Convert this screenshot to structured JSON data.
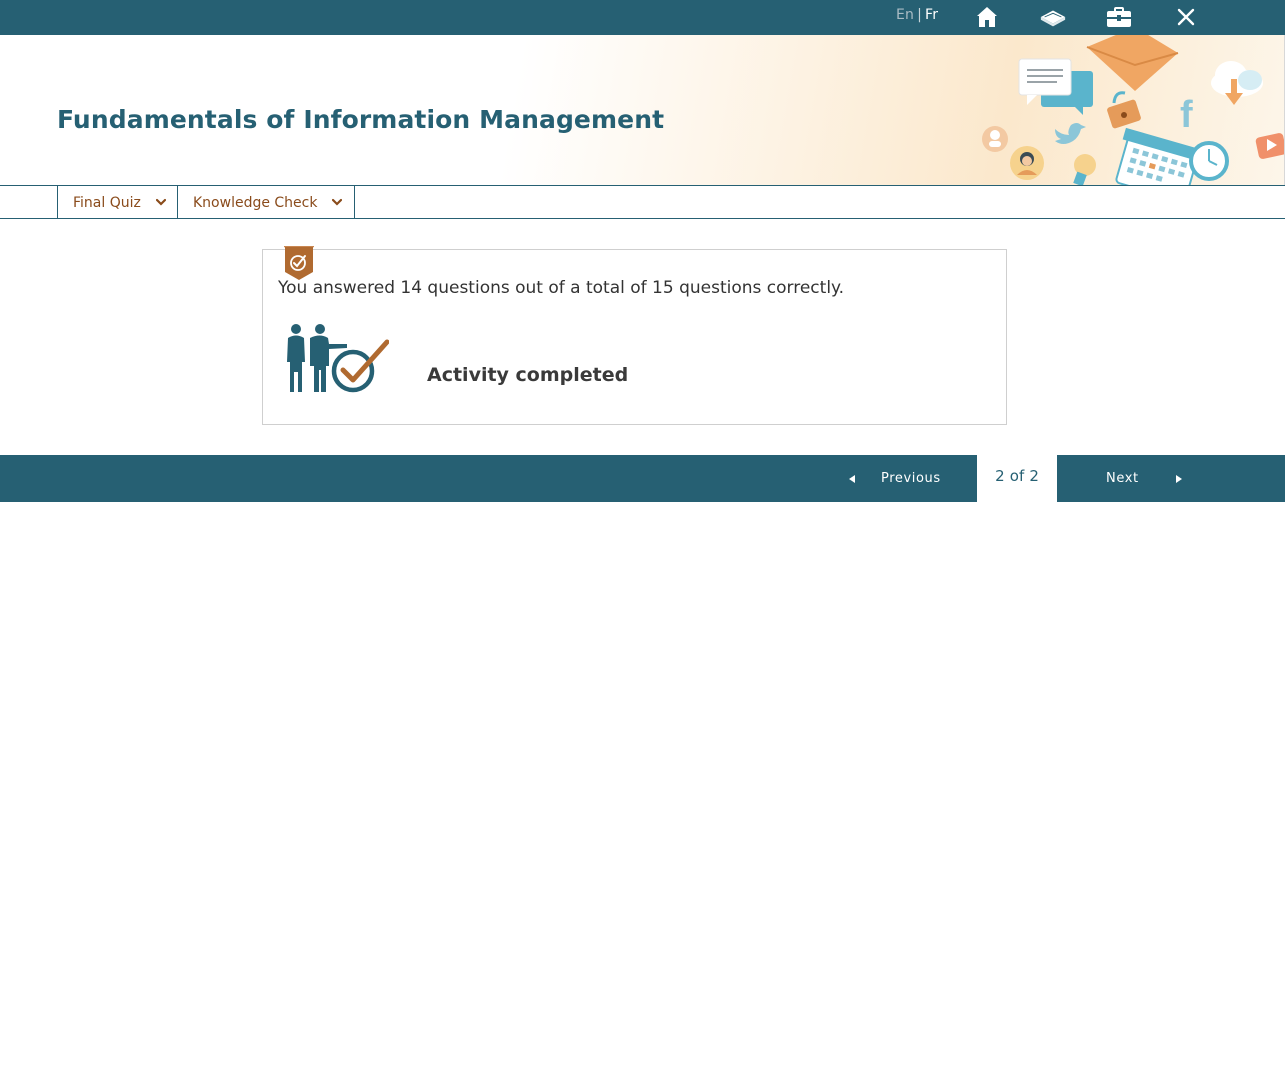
{
  "topbar": {
    "lang_en": "En",
    "lang_separator": "|",
    "lang_fr": "Fr",
    "icons": [
      "home-icon",
      "glossary-book-icon",
      "toolbox-icon",
      "close-icon"
    ]
  },
  "banner": {
    "title": "Fundamentals of Information Management"
  },
  "nav": {
    "items": [
      {
        "label": "Final Quiz"
      },
      {
        "label": "Knowledge Check"
      }
    ]
  },
  "result": {
    "message": "You answered 14 questions out of a total of 15 questions correctly.",
    "status": "Activity completed"
  },
  "footer": {
    "previous_label": "Previous",
    "next_label": "Next",
    "page_current": "2",
    "page_of": "of",
    "page_total": "2"
  },
  "colors": {
    "brand_teal": "#266073",
    "accent_brown": "#8a4b1b",
    "accent_orange": "#e59b5a",
    "icon_blue": "#5ab4cc"
  }
}
